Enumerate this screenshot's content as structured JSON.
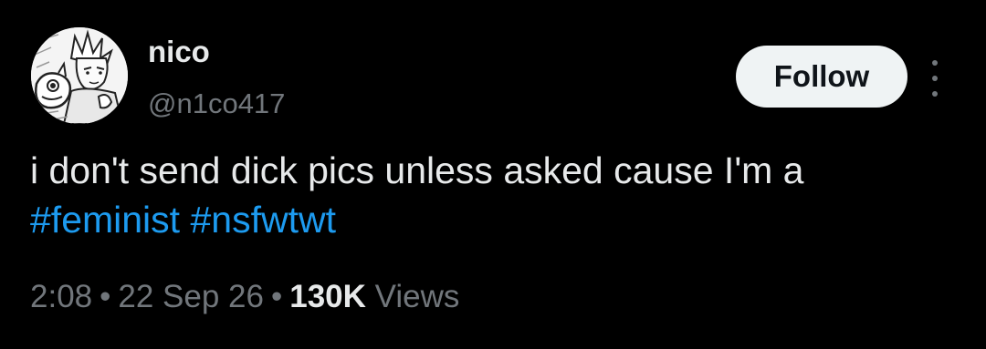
{
  "author": {
    "display_name": "nico",
    "handle": "@n1co417",
    "avatar_icon": "manga-avatar"
  },
  "follow_button": {
    "label": "Follow"
  },
  "more_menu": {
    "icon": "more-vertical-icon"
  },
  "tweet": {
    "text": "i don't send dick pics unless asked cause I'm a",
    "hashtags": [
      "#feminist",
      "#nsfwtwt"
    ]
  },
  "meta": {
    "time": "2:08",
    "separator": "•",
    "date": "22 Sep 26",
    "views_count": "130K",
    "views_label": "Views"
  },
  "colors": {
    "background": "#000000",
    "primary_text": "#e7e9ea",
    "secondary_text": "#71767b",
    "link": "#1d9bf0",
    "follow_button_bg": "#eff3f4"
  }
}
